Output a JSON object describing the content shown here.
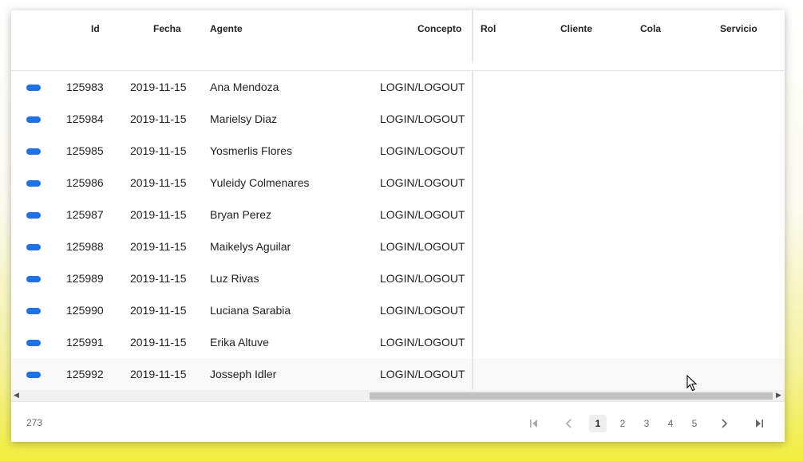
{
  "columns": {
    "id": "Id",
    "fecha": "Fecha",
    "agente": "Agente",
    "concepto": "Concepto",
    "rol": "Rol",
    "cliente": "Cliente",
    "cola": "Cola",
    "servicio": "Servicio"
  },
  "rows": [
    {
      "id": "125983",
      "fecha": "2019-11-15",
      "agente": "Ana Mendoza",
      "concepto": "LOGIN/LOGOUT"
    },
    {
      "id": "125984",
      "fecha": "2019-11-15",
      "agente": "Marielsy Diaz",
      "concepto": "LOGIN/LOGOUT"
    },
    {
      "id": "125985",
      "fecha": "2019-11-15",
      "agente": "Yosmerlis Flores",
      "concepto": "LOGIN/LOGOUT"
    },
    {
      "id": "125986",
      "fecha": "2019-11-15",
      "agente": "Yuleidy Colmenares",
      "concepto": "LOGIN/LOGOUT"
    },
    {
      "id": "125987",
      "fecha": "2019-11-15",
      "agente": "Bryan Perez",
      "concepto": "LOGIN/LOGOUT"
    },
    {
      "id": "125988",
      "fecha": "2019-11-15",
      "agente": "Maikelys Aguilar",
      "concepto": "LOGIN/LOGOUT"
    },
    {
      "id": "125989",
      "fecha": "2019-11-15",
      "agente": "Luz Rivas",
      "concepto": "LOGIN/LOGOUT"
    },
    {
      "id": "125990",
      "fecha": "2019-11-15",
      "agente": "Luciana Sarabia",
      "concepto": "LOGIN/LOGOUT"
    },
    {
      "id": "125991",
      "fecha": "2019-11-15",
      "agente": "Erika Altuve",
      "concepto": "LOGIN/LOGOUT"
    },
    {
      "id": "125992",
      "fecha": "2019-11-15",
      "agente": "Josseph Idler",
      "concepto": "LOGIN/LOGOUT"
    }
  ],
  "footer": {
    "total": "273",
    "pages": [
      "1",
      "2",
      "3",
      "4",
      "5"
    ],
    "current_page": "1"
  },
  "icons": {
    "status": "status-pill-icon",
    "first": "first-page-icon",
    "prev": "prev-page-icon",
    "next": "next-page-icon",
    "last": "last-page-icon",
    "scroll_left": "scroll-left-arrow-icon",
    "scroll_right": "scroll-right-arrow-icon"
  },
  "colors": {
    "status": "#1a73e8",
    "active_page_bg": "#eeeeee"
  }
}
